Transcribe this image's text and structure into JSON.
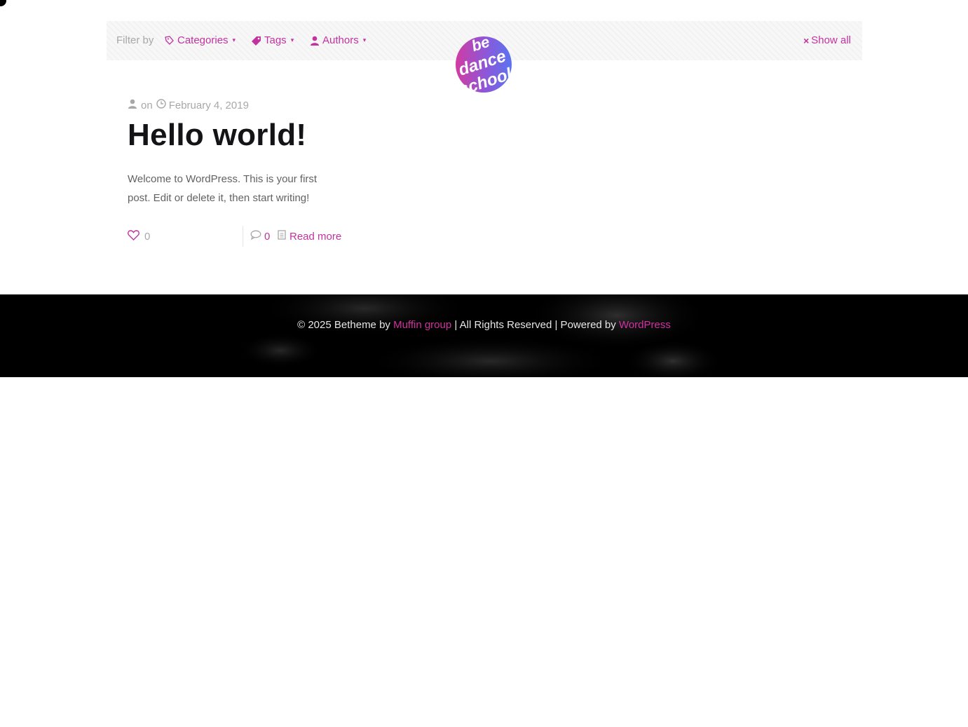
{
  "filter_bar": {
    "label": "Filter by",
    "items": [
      {
        "label": "Categories",
        "icon": "bookmark-icon"
      },
      {
        "label": "Tags",
        "icon": "tag-icon"
      },
      {
        "label": "Authors",
        "icon": "user-icon"
      }
    ],
    "caret": "▾",
    "show_all": "Show all",
    "show_all_icon": "×"
  },
  "logo": {
    "text": "be dance school",
    "colors": [
      "#d13ba2",
      "#8b58d9",
      "#5b74f0"
    ]
  },
  "post": {
    "meta_on": "on",
    "date": "February 4, 2019",
    "title": "Hello world!",
    "excerpt": "Welcome to WordPress. This is your first post. Edit or delete it, then start writing!",
    "likes": "0",
    "comments": "0",
    "read_more": "Read more"
  },
  "footer": {
    "copyright_prefix": "© 2025 Betheme by",
    "muffin_link": "Muffin group",
    "middle": "| All Rights Reserved | Powered by",
    "wordpress_link": "WordPress"
  },
  "colors": {
    "accent": "#c2339f",
    "meta_gray": "#a8a8a8",
    "title": "#141417",
    "footer_bg": "#000000"
  }
}
